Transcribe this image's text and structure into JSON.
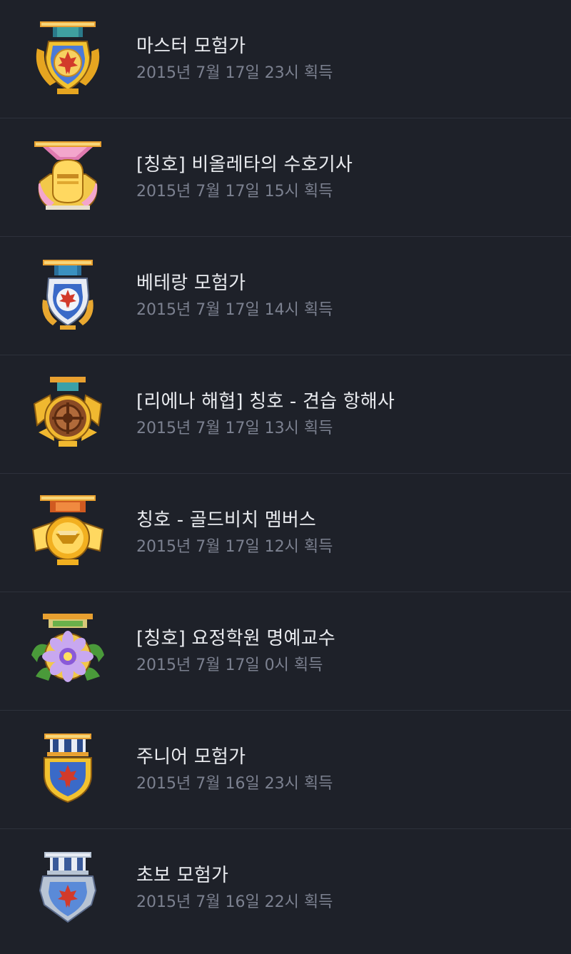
{
  "achievements": [
    {
      "title": "마스터 모험가",
      "date": "2015년 7월 17일 23시 획득",
      "icon": "master-adventurer-medal-icon",
      "colors": {
        "ribbon": "#2a7a8a",
        "body": "#d23a2a",
        "trim": "#f2c230"
      }
    },
    {
      "title": "[칭호] 비올레타의 수호기사",
      "date": "2015년 7월 17일 15시 획득",
      "icon": "violetta-guardian-knight-medal-icon",
      "colors": {
        "ribbon": "#e07ab0",
        "body": "#f2c84a",
        "trim": "#ffe08a"
      }
    },
    {
      "title": "베테랑 모험가",
      "date": "2015년 7월 17일 14시 획득",
      "icon": "veteran-adventurer-medal-icon",
      "colors": {
        "ribbon": "#2a6f9a",
        "body": "#d23a2a",
        "trim": "#e9a830"
      }
    },
    {
      "title": "[리에나 해협] 칭호 - 견습 항해사",
      "date": "2015년 7월 17일 13시 획득",
      "icon": "apprentice-navigator-medal-icon",
      "colors": {
        "ribbon": "#3aa0a8",
        "body": "#8a4a24",
        "trim": "#f0b830"
      }
    },
    {
      "title": "칭호 - 골드비치 멤버스",
      "date": "2015년 7월 17일 12시 획득",
      "icon": "gold-beach-members-medal-icon",
      "colors": {
        "ribbon": "#d05a20",
        "body": "#f2b020",
        "trim": "#ffd860"
      }
    },
    {
      "title": "[칭호] 요정학원 명예교수",
      "date": "2015년 7월 17일 0시 획득",
      "icon": "fairy-academy-professor-medal-icon",
      "colors": {
        "ribbon": "#d8c878",
        "body": "#8a5ad8",
        "trim": "#4a9a3a"
      }
    },
    {
      "title": "주니어 모험가",
      "date": "2015년 7월 16일 23시 획득",
      "icon": "junior-adventurer-medal-icon",
      "colors": {
        "ribbon": "#2a4a8a",
        "body": "#d23a2a",
        "trim": "#f2c230"
      }
    },
    {
      "title": "초보 모험가",
      "date": "2015년 7월 16일 22시 획득",
      "icon": "beginner-adventurer-medal-icon",
      "colors": {
        "ribbon": "#3a5a9a",
        "body": "#d23a2a",
        "trim": "#b8c4d4"
      }
    }
  ]
}
